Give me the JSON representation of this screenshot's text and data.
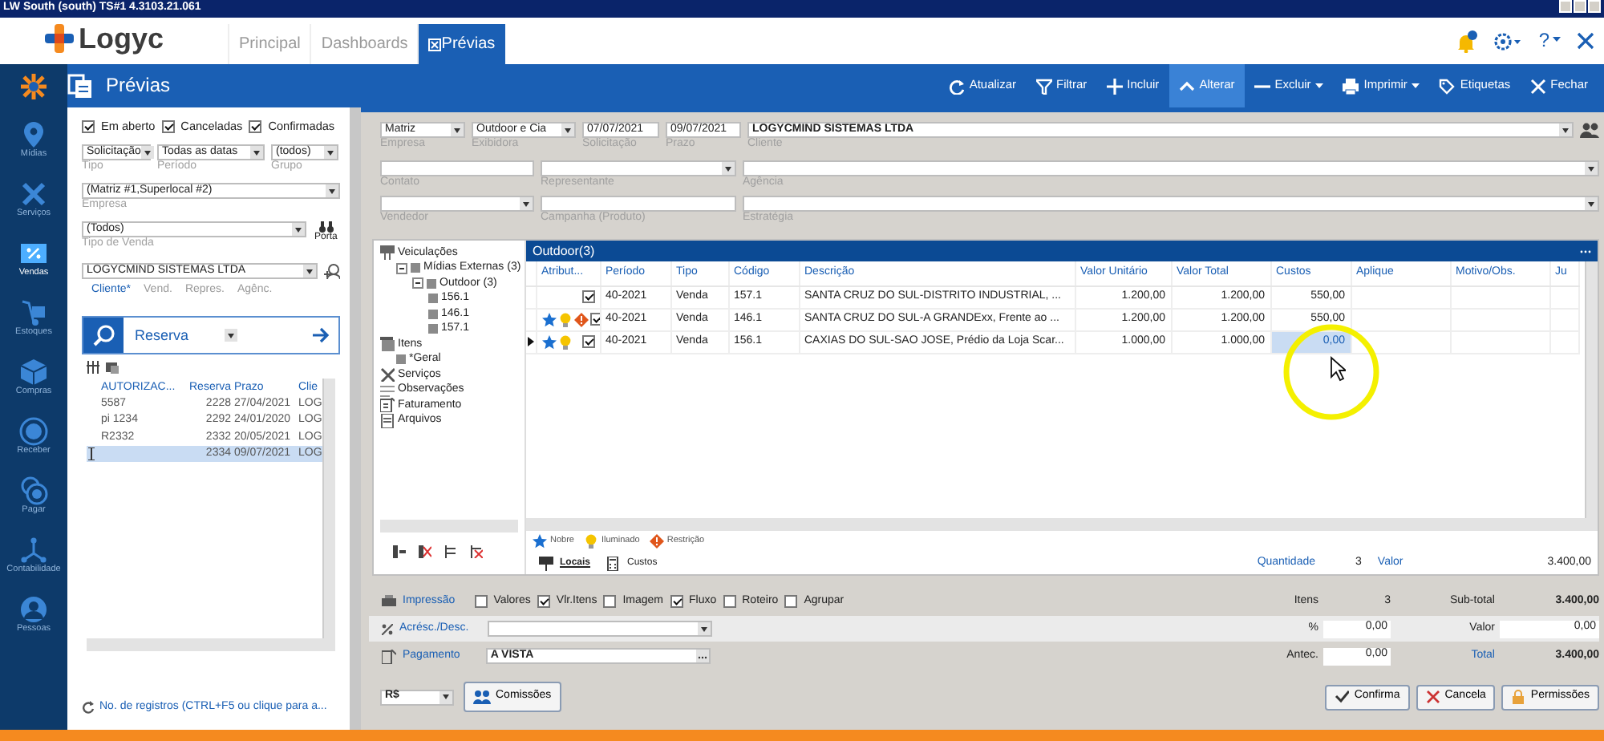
{
  "window": {
    "title": "LW South (south) TS#1 4.3103.21.061"
  },
  "header": {
    "logo": "Logyc",
    "tabs": [
      {
        "label": "Principal",
        "selected": false
      },
      {
        "label": "Dashboards",
        "selected": false
      },
      {
        "label": "Prévias",
        "selected": true
      }
    ],
    "help_label": "?"
  },
  "toolbar": {
    "title": "Prévias",
    "buttons": [
      {
        "kind": "refresh",
        "label": "Atualizar",
        "selected": false,
        "dropdown": false
      },
      {
        "kind": "filter",
        "label": "Filtrar",
        "selected": false,
        "dropdown": false
      },
      {
        "kind": "add",
        "label": "Incluir",
        "selected": false,
        "dropdown": false
      },
      {
        "kind": "edit",
        "label": "Alterar",
        "selected": true,
        "dropdown": false
      },
      {
        "kind": "delete",
        "label": "Excluir",
        "selected": false,
        "dropdown": true
      },
      {
        "kind": "print",
        "label": "Imprimir",
        "selected": false,
        "dropdown": true
      },
      {
        "kind": "labels",
        "label": "Etiquetas",
        "selected": false,
        "dropdown": false
      },
      {
        "kind": "close",
        "label": "Fechar",
        "selected": false,
        "dropdown": false
      }
    ]
  },
  "nav": [
    {
      "kind": "media",
      "label": "Mídias",
      "selected": false
    },
    {
      "kind": "services",
      "label": "Serviços",
      "selected": false
    },
    {
      "kind": "sales",
      "label": "Vendas",
      "selected": true
    },
    {
      "kind": "stock",
      "label": "Estoques",
      "selected": false
    },
    {
      "kind": "purchases",
      "label": "Compras",
      "selected": false
    },
    {
      "kind": "receive",
      "label": "Receber",
      "selected": false
    },
    {
      "kind": "pay",
      "label": "Pagar",
      "selected": false
    },
    {
      "kind": "accounting",
      "label": "Contabilidade",
      "selected": false
    },
    {
      "kind": "people",
      "label": "Pessoas",
      "selected": false
    }
  ],
  "filters": {
    "status": [
      {
        "label": "Em aberto",
        "checked": true
      },
      {
        "label": "Canceladas",
        "checked": true
      },
      {
        "label": "Confirmadas",
        "checked": true
      }
    ],
    "selects": [
      {
        "value": "Solicitação",
        "label": "Tipo"
      },
      {
        "value": "Todas as datas",
        "label": "Período"
      },
      {
        "value": "(todos)",
        "label": "Grupo"
      },
      {
        "value": "(Matriz #1,Superlocal #2)",
        "label": "Empresa"
      },
      {
        "value": "(Todos)",
        "label": "Tipo de Venda"
      }
    ],
    "porta": "Porta",
    "person": "LOGYCMIND SISTEMAS LTDA",
    "person_tabs": [
      {
        "label": "Cliente*",
        "selected": true
      },
      {
        "label": "Vend.",
        "selected": false
      },
      {
        "label": "Repres.",
        "selected": false
      },
      {
        "label": "Agênc.",
        "selected": false
      }
    ],
    "search": "Reserva",
    "list": {
      "columns": [
        "AUTORIZAC...",
        "Reserva",
        "Prazo",
        "Clie"
      ],
      "rows": [
        {
          "cells": [
            "5587",
            "2228",
            "27/04/2021",
            "LOG"
          ],
          "selected": false
        },
        {
          "cells": [
            "pi 1234",
            "2292",
            "24/01/2020",
            "LOG"
          ],
          "selected": false
        },
        {
          "cells": [
            "R2332",
            "2332",
            "20/05/2021",
            "LOG"
          ],
          "selected": false
        },
        {
          "cells": [
            "",
            "2334",
            "09/07/2021",
            "LOG"
          ],
          "selected": true
        }
      ]
    },
    "footer": "No. de registros (CTRL+F5 ou clique para a..."
  },
  "form": {
    "rows": [
      [
        {
          "kind": "select",
          "value": "Matriz",
          "label": "Empresa"
        },
        {
          "kind": "select",
          "value": "Outdoor e Cia",
          "label": "Exibidora"
        },
        {
          "kind": "text",
          "value": "07/07/2021",
          "label": "Solicitação"
        },
        {
          "kind": "text",
          "value": "09/07/2021",
          "label": "Prazo"
        },
        {
          "kind": "select",
          "value": "LOGYCMIND SISTEMAS LTDA",
          "label": "Cliente",
          "bold": true
        }
      ],
      [
        {
          "kind": "text",
          "label": "Contato"
        },
        {
          "kind": "select",
          "label": "Representante"
        },
        {
          "kind": "select",
          "label": "Agência"
        }
      ],
      [
        {
          "kind": "select",
          "label": "Vendedor"
        },
        {
          "kind": "text",
          "label": "Campanha (Produto)"
        },
        {
          "kind": "select",
          "label": "Estratégia"
        }
      ]
    ]
  },
  "tree": [
    {
      "kind": "vehicles",
      "label": "Veiculações",
      "children": [
        {
          "label": "Mídias Externas (3)",
          "expanded": true,
          "children": [
            {
              "label": "Outdoor (3)",
              "expanded": true,
              "children": [
                {
                  "label": "156.1"
                },
                {
                  "label": "146.1"
                },
                {
                  "label": "157.1"
                }
              ]
            }
          ]
        }
      ]
    },
    {
      "kind": "items",
      "label": "Itens",
      "children": [
        {
          "label": "*Geral"
        }
      ]
    },
    {
      "kind": "services",
      "label": "Serviços"
    },
    {
      "kind": "notes",
      "label": "Observações"
    },
    {
      "kind": "billing",
      "label": "Faturamento"
    },
    {
      "kind": "files",
      "label": "Arquivos"
    }
  ],
  "grid": {
    "title": "Outdoor(3)",
    "columns": [
      "Atribut...",
      "Período",
      "Tipo",
      "Código",
      "Descrição",
      "Valor Unitário",
      "Valor Total",
      "Custos",
      "Aplique",
      "Motivo/Obs.",
      "Ju"
    ],
    "rows": [
      {
        "current": false,
        "nobre": false,
        "iluminado": false,
        "restricao": false,
        "checked": true,
        "cells": [
          "",
          "40-2021",
          "Venda",
          "157.1",
          "SANTA CRUZ DO SUL-DISTRITO INDUSTRIAL, ...",
          "1.200,00",
          "1.200,00",
          "550,00"
        ]
      },
      {
        "current": false,
        "nobre": true,
        "iluminado": true,
        "restricao": true,
        "checked": true,
        "cells": [
          "",
          "40-2021",
          "Venda",
          "146.1",
          "SANTA CRUZ DO SUL-A GRANDExx, Frente ao ...",
          "1.200,00",
          "1.200,00",
          "550,00"
        ]
      },
      {
        "current": true,
        "nobre": true,
        "iluminado": true,
        "restricao": false,
        "checked": true,
        "cells": [
          "",
          "40-2021",
          "Venda",
          "156.1",
          "CAXIAS DO SUL-SAO JOSE, Prédio da Loja Scar...",
          "1.000,00",
          "1.000,00",
          "0,00"
        ]
      }
    ]
  },
  "legend": [
    {
      "kind": "nobre",
      "label": "Nobre"
    },
    {
      "kind": "iluminado",
      "label": "Iluminado"
    },
    {
      "kind": "restricao",
      "label": "Restrição"
    }
  ],
  "bottom_tabs": [
    {
      "kind": "places",
      "label": "Locais",
      "selected": true
    },
    {
      "kind": "costs",
      "label": "Custos",
      "selected": false
    }
  ],
  "summary": [
    {
      "label": "Quantidade",
      "value": "3"
    },
    {
      "label": "Valor",
      "value": "3.400,00"
    }
  ],
  "printing": {
    "label": "Impressão",
    "options": [
      {
        "label": "Valores",
        "checked": false
      },
      {
        "label": "Vlr.Itens",
        "checked": true
      },
      {
        "label": "Imagem",
        "checked": false
      },
      {
        "label": "Fluxo",
        "checked": true
      },
      {
        "label": "Roteiro",
        "checked": false
      },
      {
        "label": "Agrupar",
        "checked": false
      }
    ]
  },
  "adjustment": {
    "label": "Acrésc./Desc."
  },
  "payment": {
    "label": "Pagamento",
    "value": "A VISTA"
  },
  "totals": [
    {
      "kind": "text",
      "label": "Itens",
      "value": "3"
    },
    {
      "kind": "strong",
      "label": "Sub-total",
      "value": "3.400,00"
    },
    {
      "kind": "field",
      "label": "%",
      "value": "0,00"
    },
    {
      "kind": "field",
      "label": "Valor",
      "value": "0,00"
    },
    {
      "kind": "field",
      "label": "Antec.",
      "value": "0,00"
    },
    {
      "kind": "strong",
      "label": "Total",
      "value": "3.400,00"
    }
  ],
  "currency": "R$",
  "commissions": "Comissões",
  "actions": [
    {
      "kind": "confirm",
      "label": "Confirma"
    },
    {
      "kind": "cancel",
      "label": "Cancela"
    },
    {
      "kind": "permissions",
      "label": "Permissões"
    }
  ]
}
